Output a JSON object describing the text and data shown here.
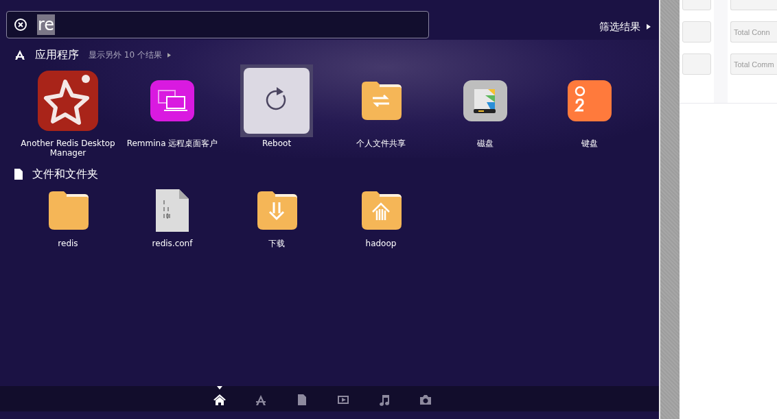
{
  "search": {
    "value": "re",
    "selected": true
  },
  "filter_button": {
    "label": "筛选结果"
  },
  "sections": [
    {
      "kind": "apps",
      "title": "应用程序",
      "more": "显示另外 10 个结果",
      "items": [
        {
          "label": "Another Redis Desktop Manager",
          "selected": false
        },
        {
          "label": "Remmina 远程桌面客户",
          "selected": false
        },
        {
          "label": "Reboot",
          "selected": true
        },
        {
          "label": "个人文件共享",
          "selected": false
        },
        {
          "label": "磁盘",
          "selected": false
        },
        {
          "label": "键盘",
          "selected": false
        }
      ]
    },
    {
      "kind": "files",
      "title": "文件和文件夹",
      "items": [
        {
          "label": "redis",
          "selected": false
        },
        {
          "label": "redis.conf",
          "selected": false
        },
        {
          "label": "下载",
          "selected": false
        },
        {
          "label": "hadoop",
          "selected": false
        }
      ]
    }
  ],
  "lenses": [
    {
      "selected": true
    },
    {
      "selected": false
    },
    {
      "selected": false
    },
    {
      "selected": false
    },
    {
      "selected": false
    },
    {
      "selected": false
    }
  ],
  "background_fields": [
    {
      "placeholder": "Total Conn"
    },
    {
      "placeholder": "Total Comm"
    }
  ]
}
